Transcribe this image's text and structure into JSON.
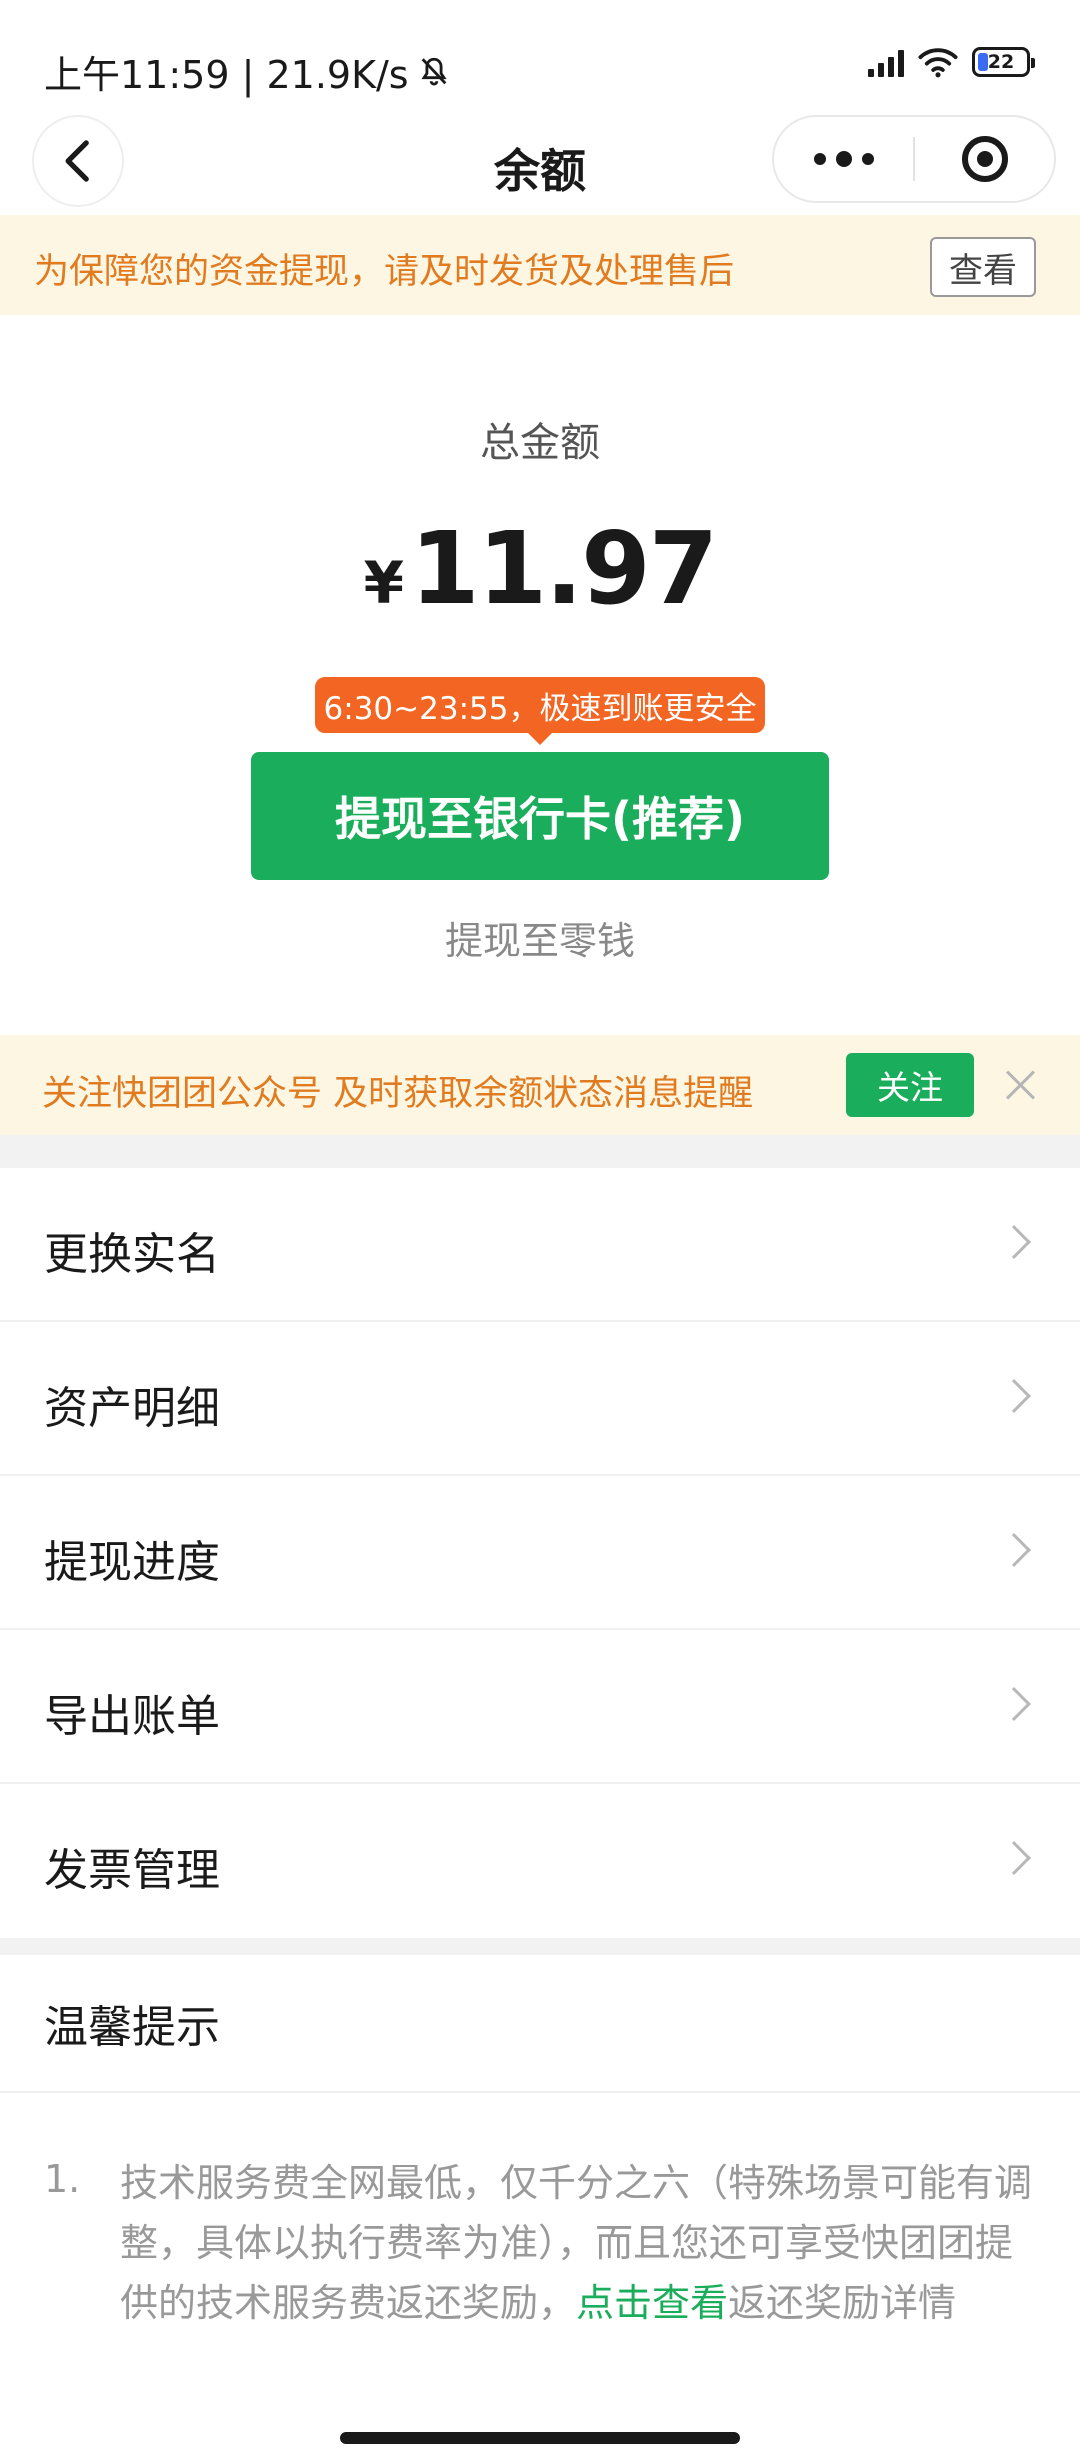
{
  "status": {
    "time_speed": "上午11:59 | 21.9K/s",
    "battery": "22"
  },
  "nav": {
    "title": "余额"
  },
  "notice": {
    "text": "为保障您的资金提现，请及时发货及处理售后",
    "button": "查看"
  },
  "balance": {
    "label": "总金额",
    "currency": "¥",
    "amount": "11.97",
    "tip": "6:30~23:55，极速到账更安全",
    "bank_button": "提现至银行卡(推荐)",
    "change_link": "提现至零钱"
  },
  "follow": {
    "text": "关注快团团公众号 及时获取余额状态消息提醒",
    "button": "关注"
  },
  "menu": [
    {
      "label": "更换实名"
    },
    {
      "label": "资产明细"
    },
    {
      "label": "提现进度"
    },
    {
      "label": "导出账单"
    },
    {
      "label": "发票管理"
    }
  ],
  "tips": {
    "title": "温馨提示",
    "item_number": "1.",
    "text_before": "技术服务费全网最低，仅千分之六（特殊场景可能有调整，具体以执行费率为准），而且您还可享受快团团提供的技术服务费返还奖励，",
    "link": "点击查看",
    "text_after": "返还奖励详情"
  },
  "colors": {
    "accent_green": "#1aad5b",
    "notice_orange": "#e17b20",
    "tip_orange": "#f26522",
    "notice_bg": "#fdf6e3"
  }
}
